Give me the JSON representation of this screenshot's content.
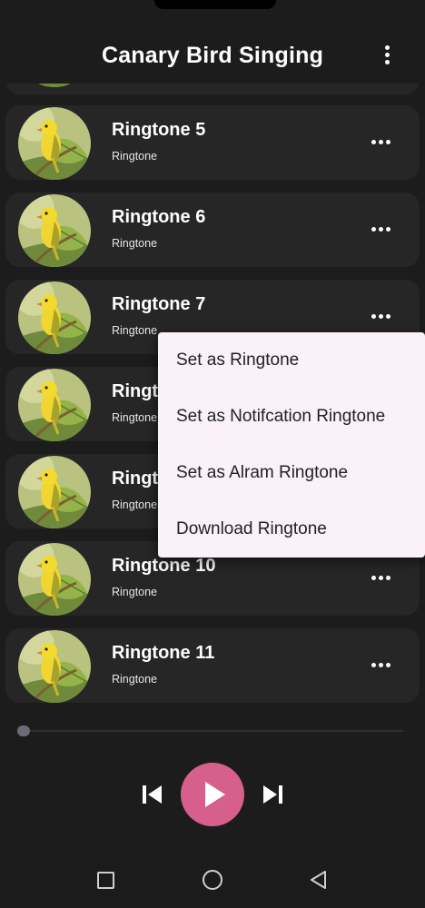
{
  "app": {
    "title": "Canary Bird Singing"
  },
  "ringtones": [
    {
      "title": "Ringtone 5",
      "subtitle": "Ringtone"
    },
    {
      "title": "Ringtone 6",
      "subtitle": "Ringtone"
    },
    {
      "title": "Ringtone 7",
      "subtitle": "Ringtone"
    },
    {
      "title": "Ringtone 8",
      "subtitle": "Ringtone"
    },
    {
      "title": "Ringtone 9",
      "subtitle": "Ringtone"
    },
    {
      "title": "Ringtone 10",
      "subtitle": "Ringtone"
    },
    {
      "title": "Ringtone 11",
      "subtitle": "Ringtone"
    }
  ],
  "context_menu": {
    "items": [
      "Set as Ringtone",
      "Set as Notifcation Ringtone",
      "Set as Alram Ringtone",
      "Download Ringtone"
    ]
  },
  "player": {
    "progress": 0
  },
  "colors": {
    "background": "#1c1c1c",
    "card": "#262626",
    "accent": "#d65f8c",
    "menu_background": "#fbf1f8"
  },
  "icons": {
    "header_menu": "more-vert-icon",
    "item_menu": "more-horiz-icon",
    "previous": "skip-previous-icon",
    "play": "play-icon",
    "next": "skip-next-icon",
    "nav_recents": "square-icon",
    "nav_home": "circle-icon",
    "nav_back": "triangle-back-icon"
  }
}
